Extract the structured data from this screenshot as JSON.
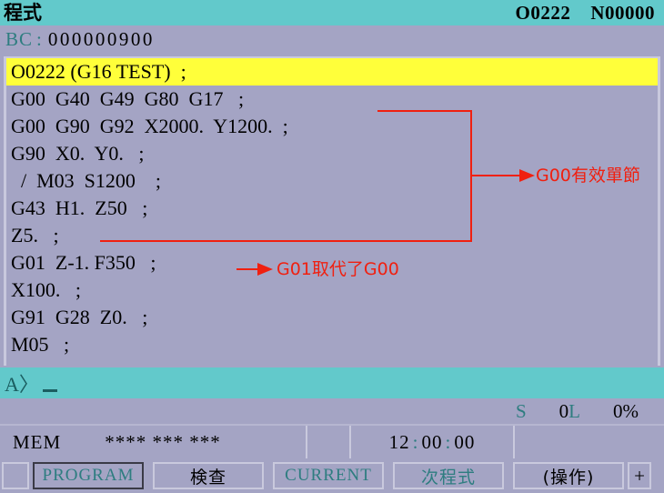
{
  "titlebar": {
    "title": "程式",
    "program_number": "O0222",
    "sequence_number": "N00000"
  },
  "bc_line": {
    "label": "BC",
    "colon": ":",
    "value": "000000900"
  },
  "program": {
    "lines": [
      {
        "text": "O0222 (G16 TEST)  ;",
        "highlighted": true
      },
      {
        "text": "G00  G40  G49  G80  G17   ;",
        "highlighted": false
      },
      {
        "text": "G00  G90  G92  X2000.  Y1200.  ;",
        "highlighted": false
      },
      {
        "text": "G90  X0.  Y0.   ;",
        "highlighted": false
      },
      {
        "text": "  /  M03  S1200    ;",
        "highlighted": false
      },
      {
        "text": "G43  H1.  Z50   ;",
        "highlighted": false
      },
      {
        "text": "Z5.   ;",
        "highlighted": false
      },
      {
        "text": "G01  Z-1. F350   ;",
        "highlighted": false
      },
      {
        "text": "X100.   ;",
        "highlighted": false
      },
      {
        "text": "G91  G28  Z0.   ;",
        "highlighted": false
      },
      {
        "text": "M05   ;",
        "highlighted": false
      }
    ]
  },
  "annotations": {
    "color": "#f02010",
    "bracket_label": "G00有效單節",
    "arrow_label": "G01取代了G00"
  },
  "input_line": {
    "prompt": "A〉"
  },
  "status_values": {
    "spindle_label": "S",
    "spindle_value": "0",
    "load_label": "L",
    "override_value": "0%"
  },
  "mem_row": {
    "mode": "MEM",
    "alarm_flags": "**** *** ***",
    "time_hours": "12",
    "time_minutes": "00",
    "time_seconds": "00",
    "time_colon": ":"
  },
  "softkeys": {
    "lead": "",
    "items": [
      {
        "label": "PROGRAM",
        "style": "teal",
        "selected": true,
        "han": false
      },
      {
        "label": "検查",
        "style": "black",
        "selected": false,
        "han": true
      },
      {
        "label": "CURRENT",
        "style": "teal",
        "selected": false,
        "han": false
      },
      {
        "label": "次程式",
        "style": "teal",
        "selected": false,
        "han": true
      },
      {
        "label": "(操作)",
        "style": "black",
        "selected": false,
        "han": true
      }
    ],
    "plus": "+"
  },
  "colors": {
    "teal": "#62c9cb",
    "teal_text": "#2e7d80",
    "background": "#a4a4c4",
    "highlight": "#ffff3a",
    "annotation_red": "#f02010"
  }
}
